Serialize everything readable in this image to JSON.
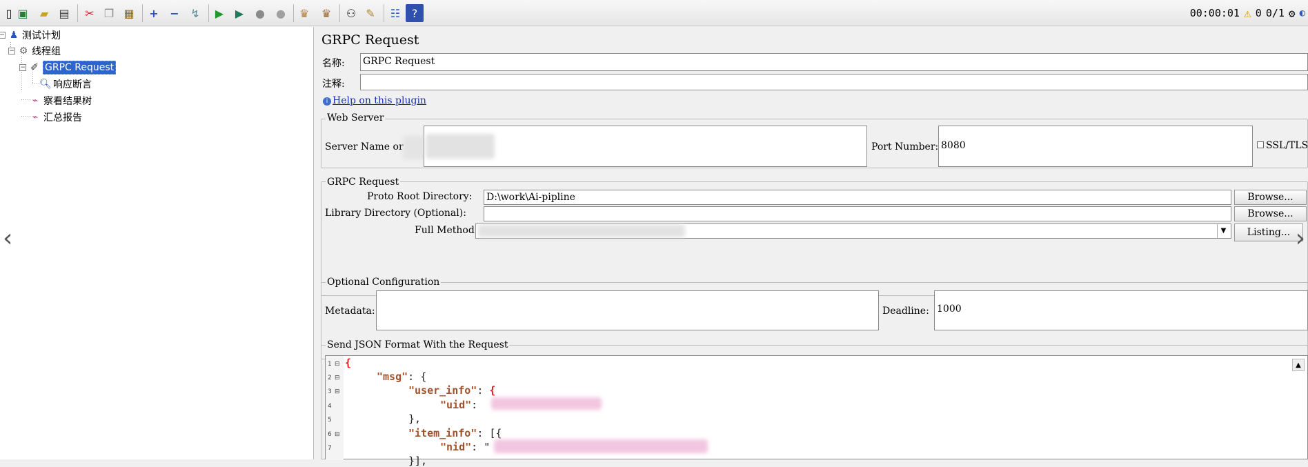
{
  "toolbar": {
    "status_time": "00:00:01",
    "status_warnings": "0",
    "status_threads": "0/1"
  },
  "tree": {
    "test_plan": "测试计划",
    "thread_group": "线程组",
    "grpc_request": "GRPC Request",
    "response_assertion": "响应断言",
    "view_results_tree": "察看结果树",
    "summary_report": "汇总报告"
  },
  "form": {
    "title": "GRPC Request",
    "name_label": "名称:",
    "name_value": "GRPC Request",
    "comment_label": "注释:",
    "comment_value": "",
    "help_link": "Help on this plugin",
    "web_server": {
      "group_title": "Web Server",
      "server_label": "Server Name or",
      "port_label": "Port Number:",
      "port_value": "8080",
      "ssl_label": "SSL/TLS"
    },
    "grpc": {
      "group_title": "GRPC Request",
      "proto_label": "Proto Root Directory:",
      "proto_value": "D:\\work\\Ai-pipline",
      "library_label": "Library Directory (Optional):",
      "library_value": "",
      "method_label": "Full Method:",
      "browse_label": "Browse...",
      "listing_label": "Listing..."
    },
    "optional": {
      "group_title": "Optional Configuration",
      "metadata_label": "Metadata:",
      "metadata_value": "",
      "deadline_label": "Deadline:",
      "deadline_value": "1000"
    },
    "json": {
      "group_title": "Send JSON Format With the Request",
      "line_numbers": [
        "1",
        "2",
        "3",
        "4",
        "5",
        "6",
        "7"
      ],
      "key_msg": "\"msg\"",
      "key_user_info": "\"user_info\"",
      "key_uid": "\"uid\"",
      "key_item_info": "\"item_info\"",
      "key_nid": "\"nid\""
    }
  },
  "colors": {
    "selection": "#2f65ca",
    "json_key": "#a0522d",
    "brace_highlight": "#dd2222",
    "link": "#1a2eb5"
  }
}
